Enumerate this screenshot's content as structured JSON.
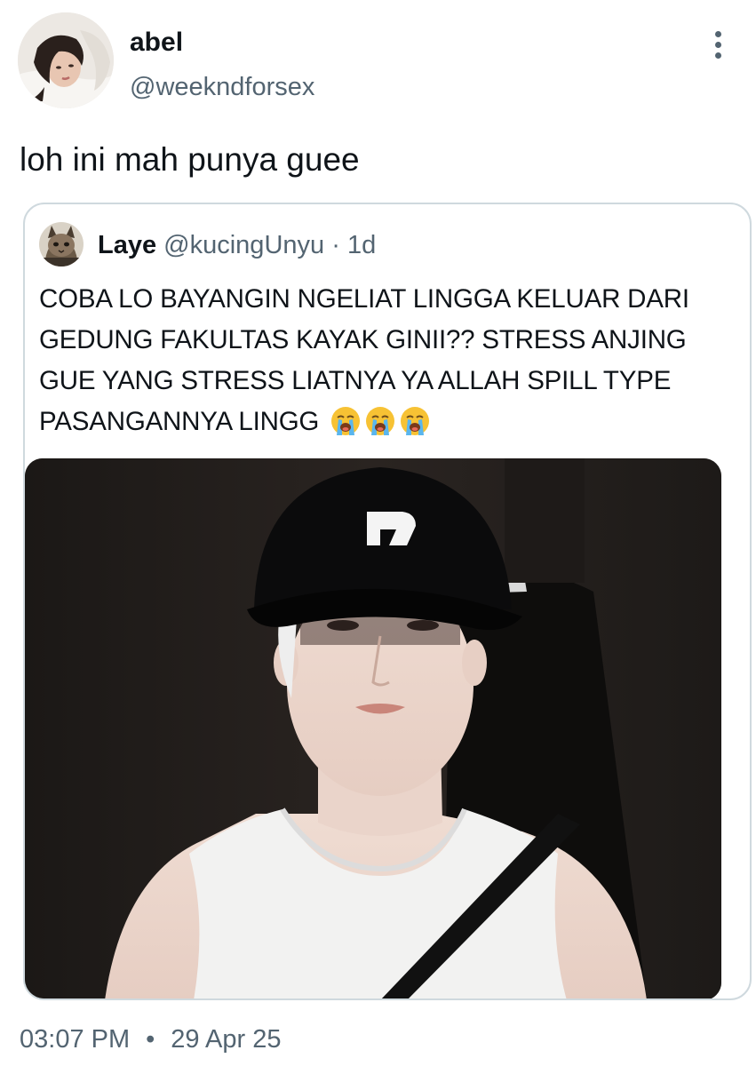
{
  "author": {
    "display_name": "abel",
    "handle": "@weekndforsex",
    "avatar_icon": "profile-photo-woman-lying-icon"
  },
  "tweet": {
    "text": "loh ini mah punya guee"
  },
  "quote": {
    "display_name": "Laye",
    "handle": "@kucingUnyu",
    "separator": "·",
    "age": "1d",
    "text": "COBA LO BAYANGIN NGELIAT LINGGA KELUAR DARI GEDUNG FAKULTAS KAYAK GINII?? STRESS ANJING GUE YANG STRESS LIATNYA YA ALLAH SPILL TYPE PASANGANNYA LINGG",
    "emojis": [
      "loudly-crying-face-icon",
      "loudly-crying-face-icon",
      "loudly-crying-face-icon"
    ],
    "media_icon": "photo-man-black-cap-white-tank-top"
  },
  "footer": {
    "time": "03:07 PM",
    "separator": "•",
    "date": "29 Apr 25"
  },
  "colors": {
    "text_primary": "#0f1419",
    "text_secondary": "#536471",
    "border": "#cfd9de"
  }
}
